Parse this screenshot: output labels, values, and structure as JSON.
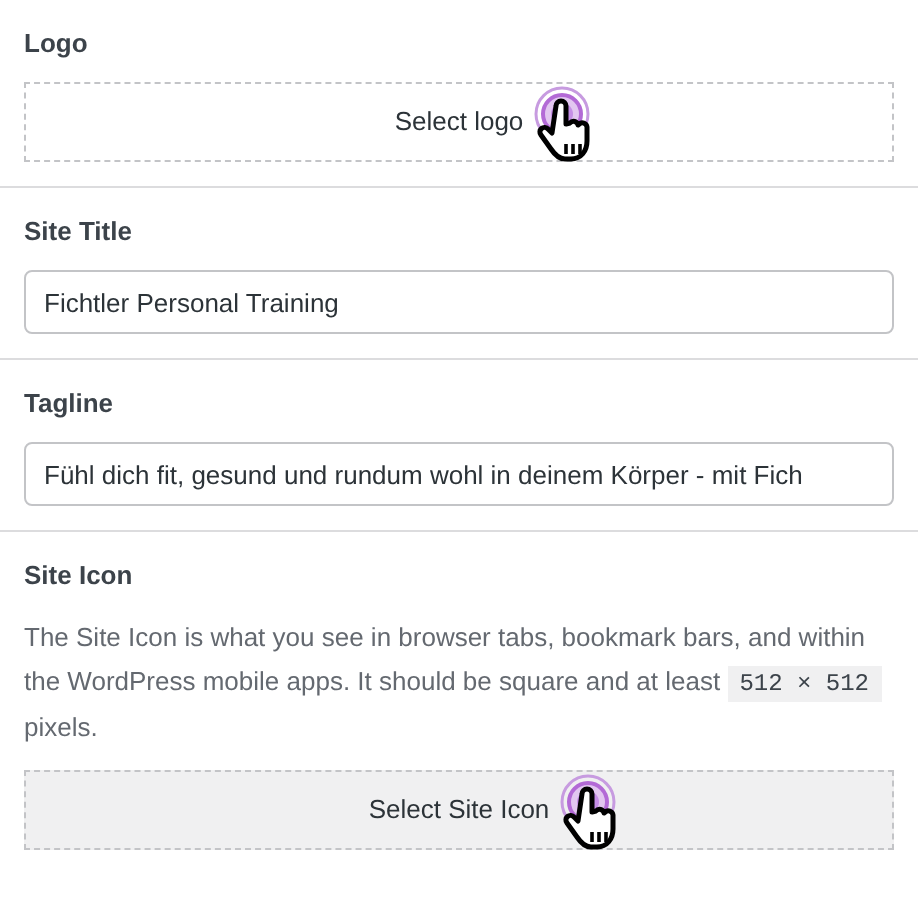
{
  "logo": {
    "label": "Logo",
    "button": "Select logo"
  },
  "site_title": {
    "label": "Site Title",
    "value": "Fichtler Personal Training"
  },
  "tagline": {
    "label": "Tagline",
    "value": "Fühl dich fit, gesund und rundum wohl in deinem Körper - mit Fich"
  },
  "site_icon": {
    "label": "Site Icon",
    "description": "The Site Icon is what you see in browser tabs, bookmark bars, and within the WordPress mobile apps. It should be square and at least",
    "size": "512 × 512",
    "description_end": "pixels.",
    "button": "Select Site Icon"
  }
}
